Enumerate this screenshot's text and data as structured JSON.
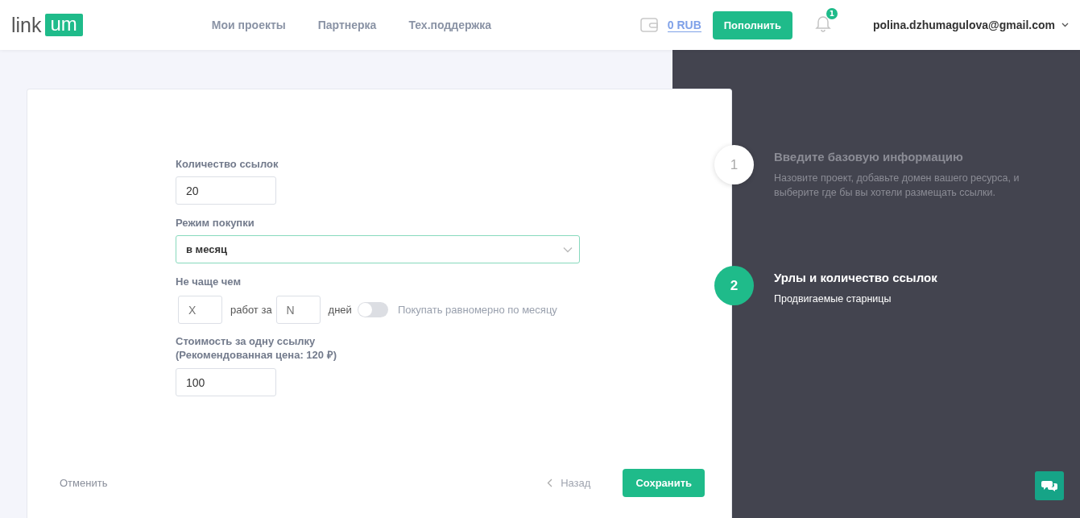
{
  "header": {
    "logo": {
      "text": "link",
      "badge": "um"
    },
    "nav": [
      "Мои проекты",
      "Партнерка",
      "Тех.поддержка"
    ],
    "balance": "0 RUB",
    "topup_button": "Пополнить",
    "notifications": {
      "count": "1"
    },
    "user": "polina.dzhumagulova@gmail.com"
  },
  "form": {
    "link_count": {
      "label": "Количество ссылок",
      "value": "20"
    },
    "purchase_mode": {
      "label": "Режим покупки",
      "value": "в месяц"
    },
    "frequency": {
      "label": "Не чаще чем",
      "x": {
        "placeholder": "X"
      },
      "works_for": "работ за",
      "n": {
        "placeholder": "N"
      },
      "days": "дней",
      "even_toggle": {
        "on": false,
        "label": "Покупать равномерно по месяцу"
      }
    },
    "price": {
      "label": "Стоимость за одну ссылку",
      "hint": "(Рекомендованная цена: 120 ₽)",
      "value": "100"
    },
    "cancel": "Отменить",
    "back": "Назад",
    "save": "Сохранить"
  },
  "steps": [
    {
      "number": "1",
      "title": "Введите базовую информацию",
      "description": "Назовите проект, добавьте домен вашего ресурса, и выберите где бы вы хотели размещать ссылки.",
      "active": false
    },
    {
      "number": "2",
      "title": "Урлы и количество ссылок",
      "description": "Продвигаемые старницы",
      "active": true
    }
  ]
}
